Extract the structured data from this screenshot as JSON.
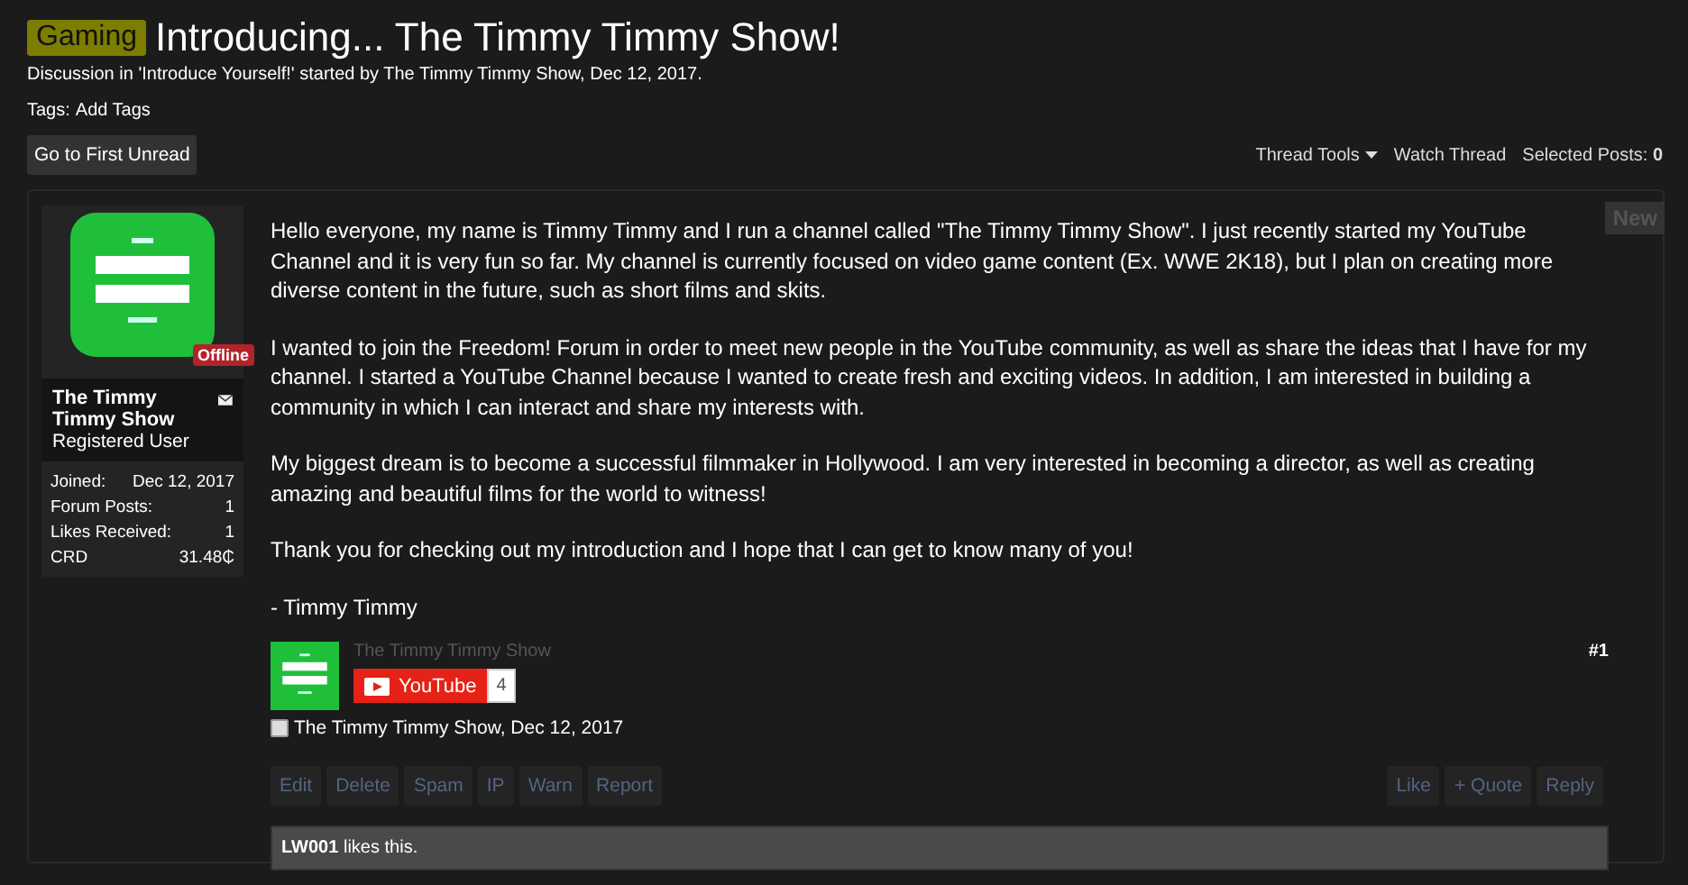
{
  "thread": {
    "prefix": "Gaming",
    "title": "Introducing... The Timmy Timmy Show!",
    "meta": "Discussion in 'Introduce Yourself!' started by The Timmy Timmy Show, Dec 12, 2017.",
    "tags_label": "Tags:",
    "tags_link": "Add Tags"
  },
  "toolbar": {
    "first_unread": "Go to First Unread",
    "links": [
      {
        "label": "Thread Tools",
        "dropdown": true
      },
      {
        "label": "Watch Thread",
        "dropdown": false
      }
    ],
    "selected_label": "Selected Posts:",
    "selected_count": "0"
  },
  "post": {
    "new_badge": "New",
    "author": {
      "status": "Offline",
      "name": "The Timmy Timmy Show",
      "title": "Registered User",
      "stats": [
        {
          "label": "Joined:",
          "value": "Dec 12, 2017"
        },
        {
          "label": "Forum Posts:",
          "value": "1"
        },
        {
          "label": "Likes Received:",
          "value": "1"
        },
        {
          "label": "CRD",
          "value": "31.48₵"
        }
      ]
    },
    "paragraphs": [
      "Hello everyone, my name is Timmy Timmy and I run a channel called \"The Timmy Timmy Show\". I just recently started my YouTube Channel and it is very fun so far. My channel is currently focused on video game content (Ex. WWE 2K18), but I plan on creating more diverse content in the future, such as short films and skits.",
      "I wanted to join the Freedom! Forum in order to meet new people in the YouTube community, as well as share the ideas that I have for my channel. I started a YouTube Channel because I wanted to create fresh and exciting videos. In addition, I am interested in building a community in which I can interact and share my interests with.",
      "My biggest dream is to become a successful filmmaker in Hollywood. I am very interested in becoming a director, as well as creating amazing and beautiful films for the world to witness!",
      "Thank you for checking out my introduction and I hope that I can get to know many of you!",
      "- Timmy Timmy"
    ],
    "signature": {
      "channel": "The Timmy Timmy Show",
      "youtube_label": "YouTube",
      "subscribers": "4"
    },
    "number": "#1",
    "select": {
      "checked": false,
      "label": "The Timmy Timmy Show, Dec 12, 2017"
    },
    "actions_left": [
      "Edit",
      "Delete",
      "Spam",
      "IP",
      "Warn",
      "Report"
    ],
    "actions_right": [
      "Like",
      "+ Quote",
      "Reply"
    ],
    "likes": {
      "user": "LW001",
      "text": "likes this."
    }
  }
}
